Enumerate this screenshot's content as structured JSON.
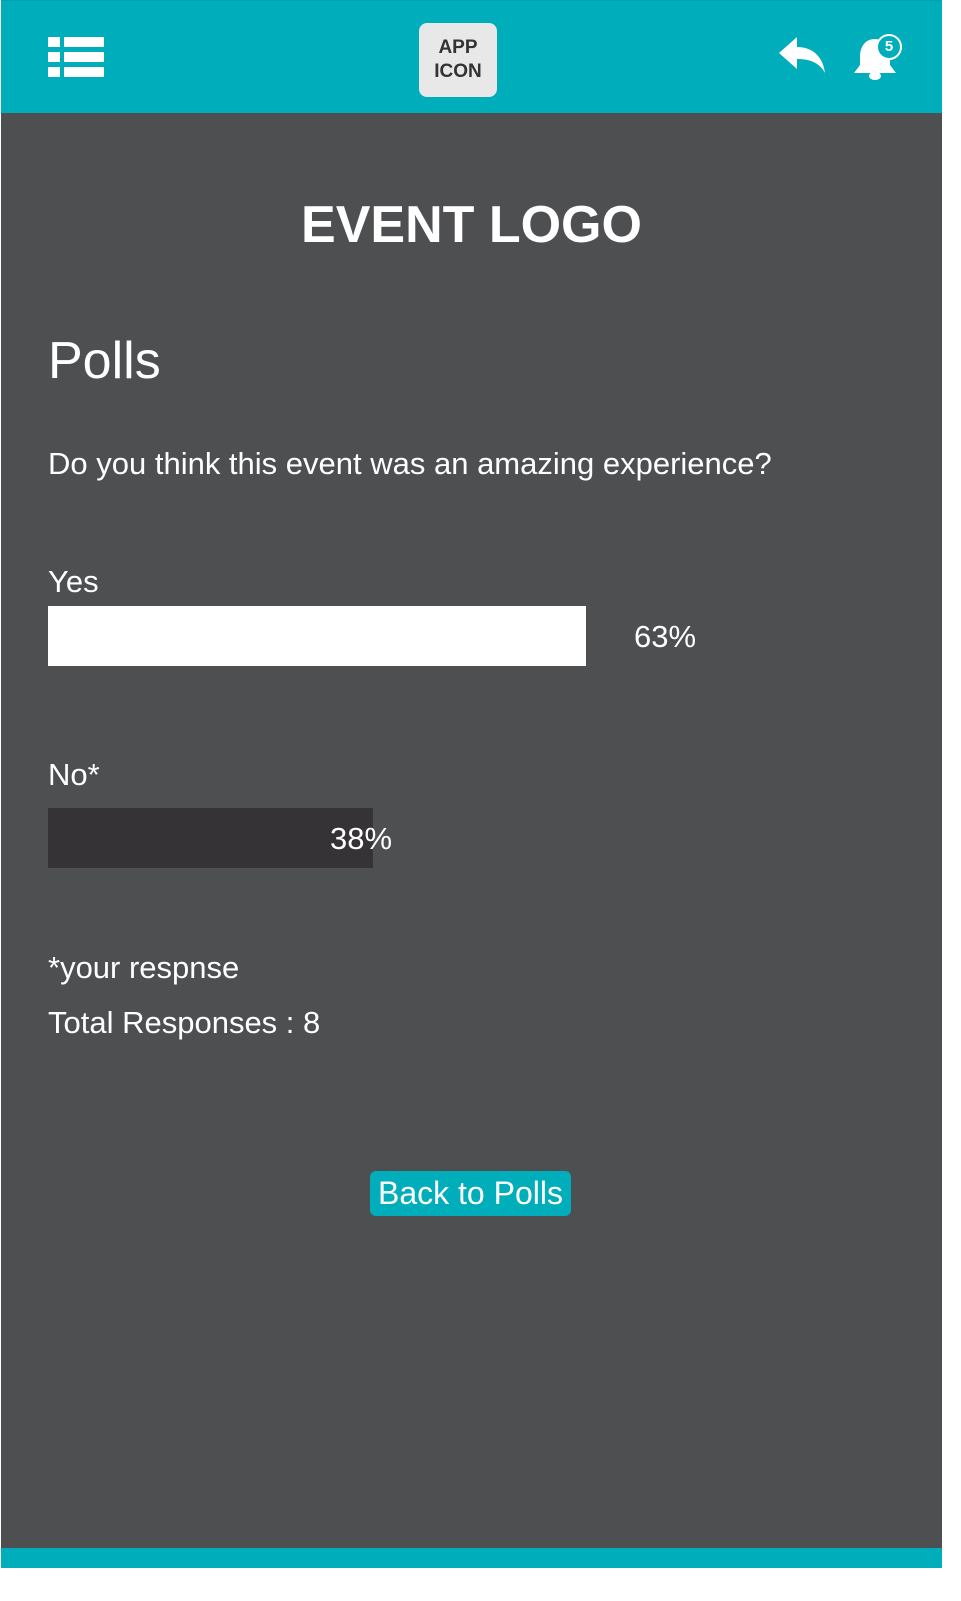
{
  "header": {
    "app_icon_line1": "APP",
    "app_icon_line2": "ICON",
    "notification_count": "5",
    "icons": [
      "list-menu-icon",
      "reply-arrow-icon",
      "bell-icon"
    ]
  },
  "event_logo": "EVENT LOGO",
  "page_title": "Polls",
  "poll": {
    "question": "Do you think this event was an amazing experience?",
    "options": [
      {
        "label": "Yes",
        "percent_label": "63%",
        "fraction": 0.63,
        "color": "#ffffff"
      },
      {
        "label": "No*",
        "percent_label": "38%",
        "fraction": 0.38,
        "color": "#353335"
      }
    ],
    "footnote": "*your respnse",
    "total_responses": "Total Responses : 8"
  },
  "back_button_label": "Back to Polls",
  "colors": {
    "accent": "#00adbb",
    "background": "#4e4f51"
  }
}
